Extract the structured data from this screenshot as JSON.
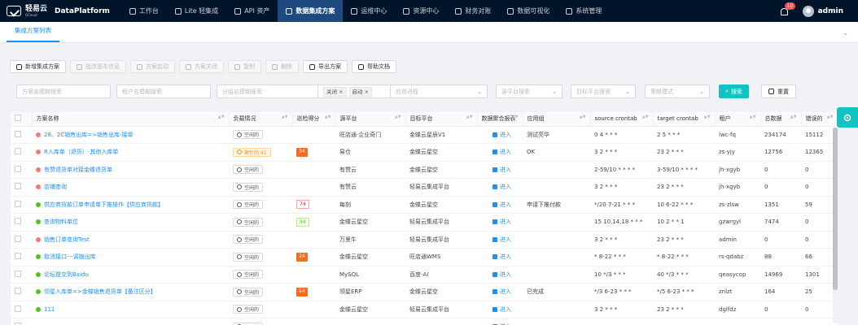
{
  "header": {
    "logo_text": "轻易云",
    "logo_sub": "QCloud",
    "brand": "DataPlatform",
    "nav": [
      {
        "label": "工作台",
        "icon": "monitor-icon"
      },
      {
        "label": "Lite 轻集成",
        "icon": "bolt-icon"
      },
      {
        "label": "API 资产",
        "icon": "api-icon"
      },
      {
        "label": "数据集成方案",
        "icon": "flow-icon",
        "active": true
      },
      {
        "label": "运维中心",
        "icon": "ops-icon"
      },
      {
        "label": "资源中心",
        "icon": "database-icon"
      },
      {
        "label": "财务对账",
        "icon": "finance-icon"
      },
      {
        "label": "数据可视化",
        "icon": "chart-icon"
      },
      {
        "label": "系统管理",
        "icon": "settings-icon"
      }
    ],
    "notification_count": "10",
    "username": "admin"
  },
  "tabs": [
    {
      "label": "集成方案列表"
    }
  ],
  "toolbar": [
    {
      "label": "新增集成方案",
      "disabled": false,
      "icon": "plus-icon"
    },
    {
      "label": "批改基本信息",
      "disabled": true,
      "icon": "edit-icon"
    },
    {
      "label": "方案启动",
      "disabled": true,
      "icon": "play-icon"
    },
    {
      "label": "方案关闭",
      "disabled": true,
      "icon": "stop-icon"
    },
    {
      "label": "复制",
      "disabled": true,
      "icon": "copy-icon"
    },
    {
      "label": "删除",
      "disabled": true,
      "icon": "delete-icon"
    },
    {
      "label": "导出方案",
      "disabled": false,
      "icon": "export-icon"
    },
    {
      "label": "帮助文档",
      "disabled": false,
      "icon": "help-icon"
    }
  ],
  "filters": {
    "plan_name": "方案名模糊搜索",
    "tenant_name": "租户名模糊搜索",
    "group_name": "分组名模糊搜索",
    "status_tags": [
      "关闭",
      "启动"
    ],
    "app_process": "应用进程",
    "source_platform": "源平台搜索",
    "target_platform": "目标平台搜索",
    "strategy": "策略模式",
    "search_label": "搜索",
    "reset_label": "重置"
  },
  "table": {
    "columns": [
      "方案名称",
      "负载情况",
      "巡检得分",
      "源平台",
      "目标平台",
      "数据聚合报表",
      "应用组",
      "source crontab",
      "target crontab",
      "租户",
      "总数据",
      "错误的"
    ],
    "rows": [
      {
        "dot": "red",
        "name": "28、2C销售出库=>销售出库-接单",
        "load": "空闲的",
        "load_warn": false,
        "score": "",
        "score_style": "",
        "source": "旺店通·企业奇门",
        "target": "金蝶云星辰V1",
        "report": "进入",
        "group": "测试亮华",
        "src_cron": "0 4 * * *",
        "tgt_cron": "2 5 * * *",
        "tenant": "lwc-fq",
        "total": "234174",
        "errors": "15112"
      },
      {
        "dot": "red",
        "name": "R入库单（退货）-其他入库单",
        "load": "繁忙的:41",
        "load_warn": true,
        "score": "34",
        "score_style": "orange",
        "source": "易仓",
        "target": "金蝶云星空",
        "report": "进入",
        "group": "OK",
        "src_cron": "3 2 * * *",
        "tgt_cron": "23 2 * * *",
        "tenant": "zs-yjy",
        "total": "12756",
        "errors": "12365"
      },
      {
        "dot": "red",
        "name": "有赞退货单对接金蝶退货单",
        "load": "空闲的",
        "load_warn": false,
        "score": "",
        "score_style": "",
        "source": "有赞云",
        "target": "金蝶云星空",
        "report": "进入",
        "group": "",
        "src_cron": "2-59/10 * * * *",
        "tgt_cron": "3-59/10 * * * *",
        "tenant": "jh-xgyb",
        "total": "0",
        "errors": "0"
      },
      {
        "dot": "red",
        "name": "店铺查询",
        "load": "空闲的",
        "load_warn": false,
        "score": "",
        "score_style": "",
        "source": "有赞云",
        "target": "轻易云集成平台",
        "report": "进入",
        "group": "",
        "src_cron": "3 2 * * *",
        "tgt_cron": "23 2 * * *",
        "tenant": "jh-xgyb",
        "total": "0",
        "errors": "0"
      },
      {
        "dot": "green",
        "name": "供应商货款订单申请单下推操作【供应商货款】",
        "load": "空闲的",
        "load_warn": false,
        "score": "74",
        "score_style": "pink",
        "source": "每刻",
        "target": "金蝶云星空",
        "report": "进入",
        "group": "申请下推付款",
        "src_cron": "*/20 7-21 * * *",
        "tgt_cron": "10 6-22 * * *",
        "tenant": "zs-zlsw",
        "total": "1351",
        "errors": "59"
      },
      {
        "dot": "green",
        "name": "查询物料单位",
        "load": "空闲的",
        "load_warn": false,
        "score": "94",
        "score_style": "lgreen",
        "source": "金蝶云星空",
        "target": "轻易云集成平台",
        "report": "进入",
        "group": "",
        "src_cron": "15 10,14,18 * * *",
        "tgt_cron": "10 2 * * 1",
        "tenant": "gzwrgyl",
        "total": "7474",
        "errors": "0"
      },
      {
        "dot": "red",
        "name": "销售订单查询Test",
        "load": "空闲的",
        "load_warn": false,
        "score": "",
        "score_style": "",
        "source": "万里牛",
        "target": "轻易云集成平台",
        "report": "进入",
        "group": "",
        "src_cron": "3 2 * * *",
        "tgt_cron": "23 2 * * *",
        "tenant": "admin",
        "total": "0",
        "errors": "0"
      },
      {
        "dot": "green",
        "name": "取消接口---调拨出库",
        "load": "空闲的",
        "load_warn": false,
        "score": "24",
        "score_style": "orange",
        "source": "金蝶云星空",
        "target": "旺店通WMS",
        "report": "进入",
        "group": "",
        "src_cron": "* 8-22 * * *",
        "tgt_cron": "* 8-22 * * *",
        "tenant": "rs-qdabz",
        "total": "88",
        "errors": "66"
      },
      {
        "dot": "green",
        "name": "论坛提交到Baidu",
        "load": "空闲的",
        "load_warn": false,
        "score": "",
        "score_style": "",
        "source": "MySQL",
        "target": "百度-AI",
        "report": "进入",
        "group": "",
        "src_cron": "10 */3 * * *",
        "tgt_cron": "40 */3 * * *",
        "tenant": "qeasycop",
        "total": "14969",
        "errors": "1301"
      },
      {
        "dot": "green",
        "name": "领星入库单=>金蝶销售退货单【备注区分】",
        "load": "空闲的",
        "load_warn": false,
        "score": "54",
        "score_style": "orange",
        "source": "领星ERP",
        "target": "金蝶云星空",
        "report": "进入",
        "group": "已完成",
        "src_cron": "*/3 6-23 * * *",
        "tgt_cron": "*/5 6-23 * * *",
        "tenant": "znlzt",
        "total": "164",
        "errors": "25"
      },
      {
        "dot": "green",
        "name": "111",
        "load": "空闲的",
        "load_warn": false,
        "score": "",
        "score_style": "",
        "source": "金蝶云星空",
        "target": "轻易云集成平台",
        "report": "进入",
        "group": "",
        "src_cron": "3 2 * * *",
        "tgt_cron": "23 2 * * *",
        "tenant": "dglfdz",
        "total": "0",
        "errors": "0"
      },
      {
        "dot": "",
        "name": "",
        "load": "空闲的",
        "load_warn": false,
        "score": "",
        "score_style": "",
        "source": "",
        "target": "",
        "report": "进入",
        "group": "",
        "src_cron": "",
        "tgt_cron": "",
        "tenant": "",
        "total": "",
        "errors": ""
      }
    ]
  }
}
